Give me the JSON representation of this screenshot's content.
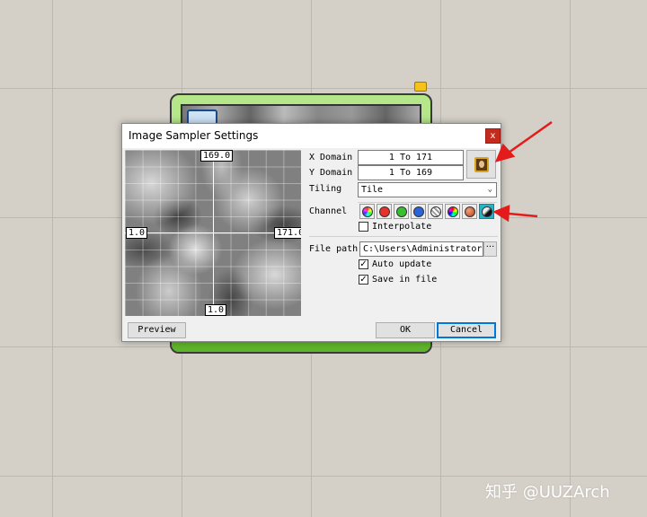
{
  "dialog": {
    "title": "Image Sampler Settings",
    "close_label": "x"
  },
  "preview_canvas": {
    "labels": {
      "top": "169.0",
      "left": "1.0",
      "right": "171.0",
      "bottom": "1.0"
    }
  },
  "settings": {
    "x_domain_label": "X Domain",
    "x_domain_value": "1 To 171",
    "y_domain_label": "Y Domain",
    "y_domain_value": "1 To 169",
    "tiling_label": "Tiling",
    "tiling_value": "Tile",
    "channel_label": "Channel",
    "interpolate_label": "Interpolate",
    "interpolate_checked": false,
    "file_path_label": "File path",
    "file_path_value": "C:\\Users\\Administrator\\De",
    "browse_label": "···",
    "auto_update_label": "Auto update",
    "auto_update_checked": true,
    "save_in_file_label": "Save in file",
    "save_in_file_checked": true
  },
  "channels": [
    {
      "name": "colour-icon"
    },
    {
      "name": "red-icon"
    },
    {
      "name": "green-icon"
    },
    {
      "name": "blue-icon"
    },
    {
      "name": "alpha-icon"
    },
    {
      "name": "hue-icon"
    },
    {
      "name": "saturation-icon"
    },
    {
      "name": "brightness-icon",
      "selected": true
    }
  ],
  "buttons": {
    "preview": "Preview",
    "ok": "OK",
    "cancel": "Cancel"
  },
  "colors": {
    "component_fill": "#b5e68a",
    "selected_channel": "#28b4c8",
    "arrow": "#e41b1b",
    "close_button": "#c42b1c"
  },
  "watermark": "知乎 @UUZArch"
}
